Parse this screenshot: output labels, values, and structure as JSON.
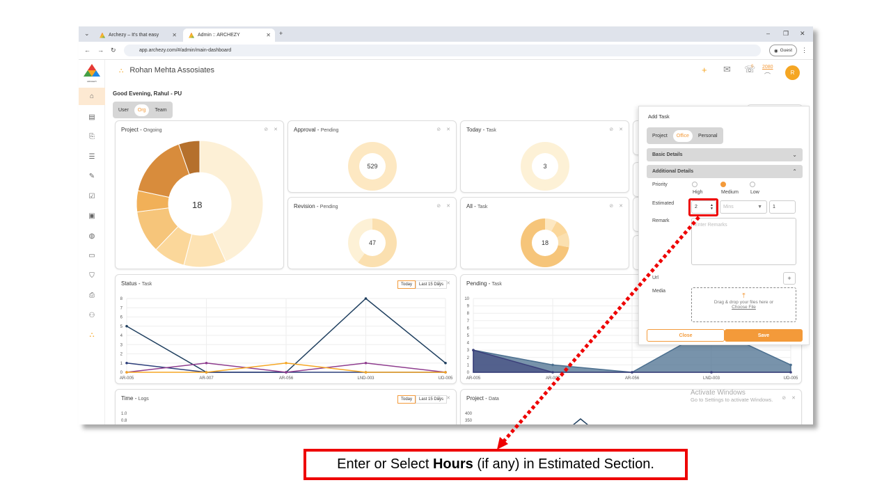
{
  "browser": {
    "tabs": [
      {
        "label": "Archezy – It's that easy"
      },
      {
        "label": "Admin :: ARCHEZY"
      }
    ],
    "url": "app.archezy.com/#/admin/main-dashboard",
    "guest_label": "Guest"
  },
  "header": {
    "company": "Rohan Mehta Assosiates",
    "notification_count": "0",
    "points": "2080",
    "avatar_initial": "R",
    "greeting": "Good Evening, Rahul - PU",
    "view_toggle": [
      "User",
      "Org",
      "Team"
    ],
    "sidebar_logo": "ARCHEZY"
  },
  "cards": {
    "project": {
      "title": "Project",
      "sub": "Ongoing",
      "value": "18"
    },
    "approval": {
      "title": "Approval",
      "sub": "Pending",
      "value": "529"
    },
    "today": {
      "title": "Today",
      "sub": "Task",
      "value": "3"
    },
    "revision": {
      "title": "Revision",
      "sub": "Pending",
      "value": "47"
    },
    "all": {
      "title": "All",
      "sub": "Task",
      "value": "18"
    },
    "status": {
      "title": "Status",
      "sub": "Task",
      "seg_today": "Today",
      "seg_last": "Last 15 Days"
    },
    "pending": {
      "title": "Pending",
      "sub": "Task"
    },
    "time": {
      "title": "Time",
      "sub": "Logs",
      "seg_today": "Today",
      "seg_last": "Last 15 Days"
    },
    "projectdata": {
      "title": "Project",
      "sub": "Data"
    }
  },
  "chart_data": [
    {
      "type": "pie",
      "title": "Project - Ongoing",
      "center_label": "18",
      "slices": [
        8,
        2,
        1.5,
        2,
        1,
        3,
        1
      ]
    },
    {
      "type": "line",
      "title": "Status - Task",
      "categories": [
        "AR-005",
        "AR-007",
        "AR-056",
        "LND-003",
        "UD-005"
      ],
      "ylim": [
        0,
        8
      ],
      "yticks": [
        "0",
        "1",
        "2",
        "3",
        "4",
        "5",
        "6",
        "7",
        "8"
      ],
      "series": [
        {
          "values": [
            5,
            0,
            0,
            8,
            1
          ],
          "color": "#1f3f5f"
        },
        {
          "values": [
            1,
            0,
            0,
            0,
            0
          ],
          "color": "#2c3e7a"
        },
        {
          "values": [
            0,
            1,
            0,
            1,
            0
          ],
          "color": "#8e3c8e"
        },
        {
          "values": [
            0,
            0,
            1,
            0,
            0
          ],
          "color": "#f5a623"
        }
      ]
    },
    {
      "type": "area",
      "title": "Pending - Task",
      "categories": [
        "AR-005",
        "AR-007",
        "AR-056",
        "LND-003",
        "UD-005"
      ],
      "ylim": [
        0,
        10
      ],
      "yticks": [
        "0",
        "1",
        "2",
        "3",
        "4",
        "5",
        "6",
        "7",
        "8",
        "9",
        "10"
      ],
      "series": [
        {
          "values": [
            3,
            1,
            0,
            6,
            1
          ],
          "color": "#4b6f8f"
        },
        {
          "values": [
            3,
            0,
            0,
            0,
            0
          ],
          "color": "#3b3f7a"
        }
      ]
    },
    {
      "type": "line",
      "title": "Time - Logs",
      "yticks": [
        "1.0",
        "0.8"
      ]
    },
    {
      "type": "line",
      "title": "Project - Data",
      "yticks": [
        "400",
        "350"
      ]
    }
  ],
  "add_task": {
    "title": "Add Task",
    "type_tabs": [
      "Project",
      "Office",
      "Personal"
    ],
    "basic_details": "Basic Details",
    "additional_details": "Additional Details",
    "priority_label": "Priority",
    "priorities": [
      "High",
      "Medium",
      "Low"
    ],
    "estimated_label": "Estimated",
    "hours_value": "2",
    "mins_placeholder": "Mins",
    "qty_value": "1",
    "remark_label": "Remark",
    "remark_placeholder": "Enter Remarks",
    "url_label": "Url",
    "media_label": "Media",
    "drop_text": "Drag & drop your files here or",
    "choose_file": "Choose File",
    "close_button": "Close",
    "save_button": "Save"
  },
  "watermark": {
    "line1": "Activate Windows",
    "line2": "Go to Settings to activate Windows."
  },
  "callout": {
    "pre": "Enter or Select ",
    "bold": "Hours",
    "post": " (if any) in Estimated Section."
  }
}
